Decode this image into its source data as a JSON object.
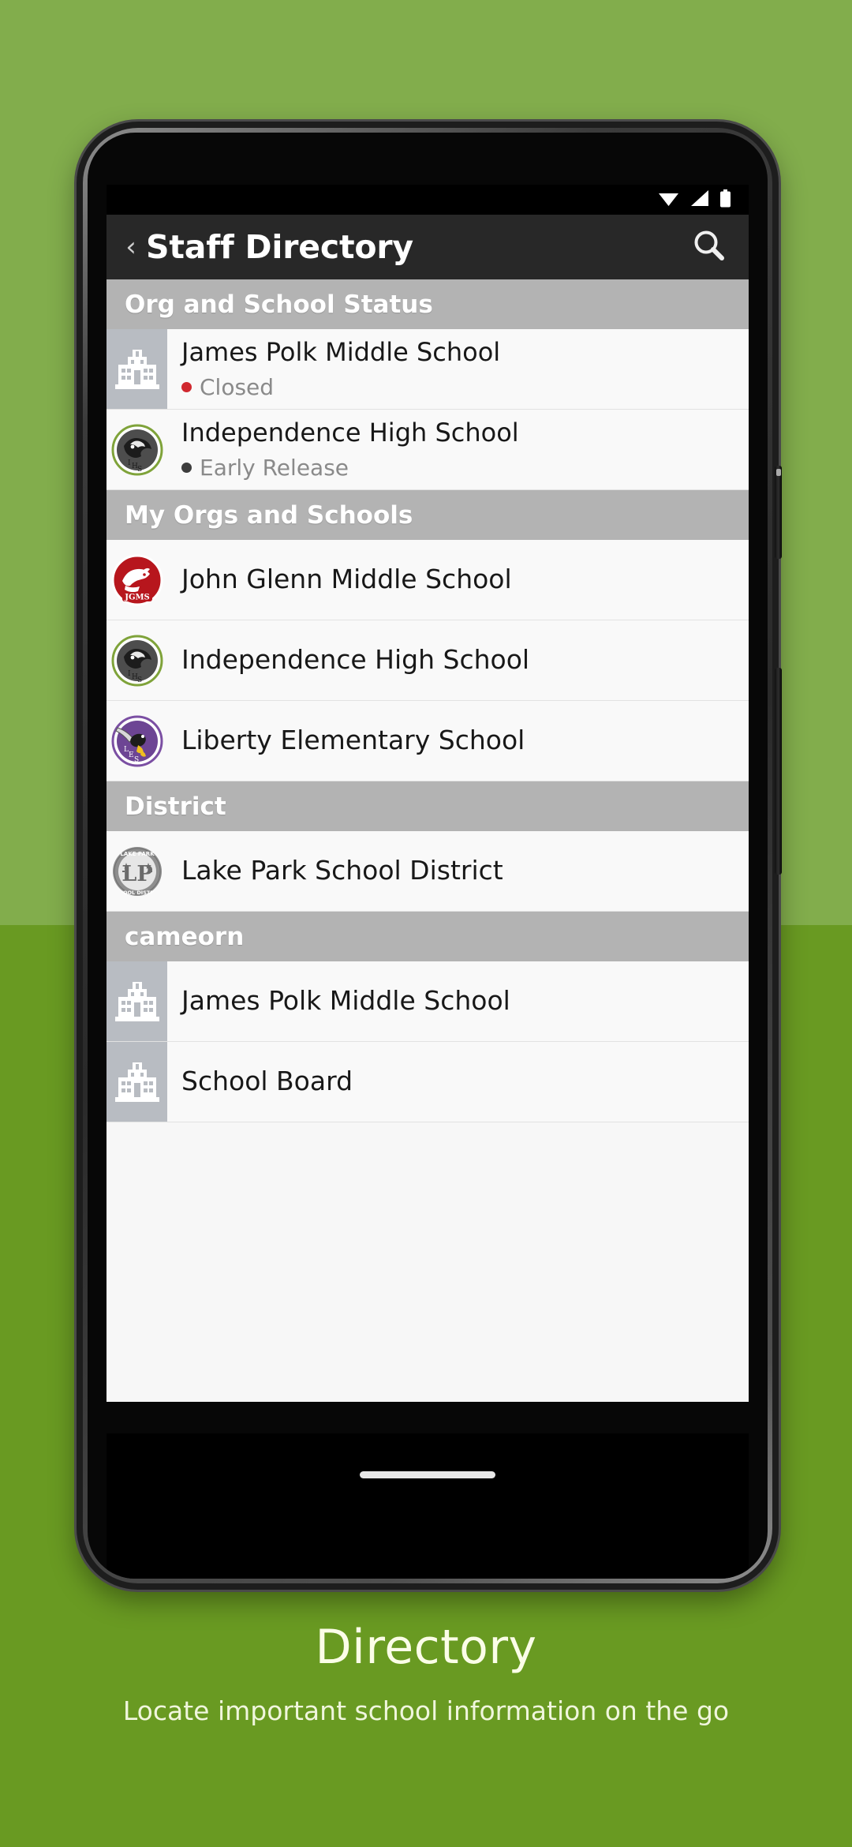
{
  "background": {
    "top_color": "#82ad4c",
    "bottom_color": "#699a22"
  },
  "statusbar": {
    "icons": [
      "wifi-icon",
      "cell-signal-icon",
      "battery-icon"
    ]
  },
  "appbar": {
    "back_label": "‹",
    "title": "Staff Directory",
    "search_icon": "search-icon",
    "background_color": "#282828"
  },
  "sections": [
    {
      "header": "Org and School Status",
      "rows": [
        {
          "title": "James Polk Middle School",
          "status_text": "Closed",
          "status_color": "#d0282f",
          "icon": "school-building-icon",
          "icon_type": "placeholder"
        },
        {
          "title": "Independence High School",
          "status_text": "Early Release",
          "status_color": "#3d3d3d",
          "icon": "independence-high-school-crest",
          "icon_type": "crest-ihs"
        }
      ]
    },
    {
      "header": "My Orgs and Schools",
      "rows": [
        {
          "title": "John Glenn Middle School",
          "status_text": "",
          "status_color": "",
          "icon": "john-glenn-middle-school-crest",
          "icon_type": "crest-jgms"
        },
        {
          "title": "Independence High School",
          "status_text": "",
          "status_color": "",
          "icon": "independence-high-school-crest",
          "icon_type": "crest-ihs"
        },
        {
          "title": "Liberty Elementary School",
          "status_text": "",
          "status_color": "",
          "icon": "liberty-elementary-school-crest",
          "icon_type": "crest-les"
        }
      ]
    },
    {
      "header": "District",
      "rows": [
        {
          "title": "Lake Park School District",
          "status_text": "",
          "status_color": "",
          "icon": "lake-park-school-district-crest",
          "icon_type": "crest-lpsd"
        }
      ]
    },
    {
      "header": "cameorn",
      "rows": [
        {
          "title": "James Polk Middle School",
          "status_text": "",
          "status_color": "",
          "icon": "school-building-icon",
          "icon_type": "placeholder"
        },
        {
          "title": "School Board",
          "status_text": "",
          "status_color": "",
          "icon": "school-building-icon",
          "icon_type": "placeholder"
        }
      ]
    }
  ],
  "caption": {
    "title": "Directory",
    "subtitle": "Locate important school information on the go"
  }
}
